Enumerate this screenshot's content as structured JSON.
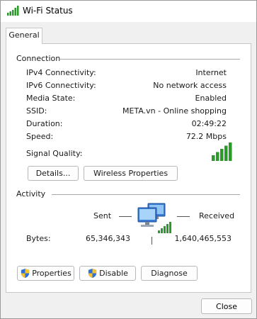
{
  "window": {
    "title": "Wi-Fi Status"
  },
  "tabs": [
    {
      "label": "General"
    }
  ],
  "connection": {
    "heading": "Connection",
    "rows": [
      {
        "label": "IPv4 Connectivity:",
        "value": "Internet"
      },
      {
        "label": "IPv6 Connectivity:",
        "value": "No network access"
      },
      {
        "label": "Media State:",
        "value": "Enabled"
      },
      {
        "label": "SSID:",
        "value": "META.vn - Online shopping"
      },
      {
        "label": "Duration:",
        "value": "02:49:22"
      },
      {
        "label": "Speed:",
        "value": "72.2 Mbps"
      }
    ],
    "signal_label": "Signal Quality:",
    "signal_bars": 5,
    "details_button": "Details...",
    "wireless_button": "Wireless Properties"
  },
  "activity": {
    "heading": "Activity",
    "sent_label": "Sent",
    "received_label": "Received",
    "bytes_label": "Bytes:",
    "bytes_sent": "65,346,343",
    "bytes_received": "1,640,465,553",
    "properties_button": "Properties",
    "disable_button": "Disable",
    "diagnose_button": "Diagnose"
  },
  "footer": {
    "close_button": "Close"
  },
  "colors": {
    "signal": "#2a9a2a",
    "shield_blue": "#2f6fd6",
    "shield_yellow": "#f2c230"
  },
  "icons": {
    "title": "wifi-signal-icon",
    "activity": "network-computers-icon",
    "button_shield": "uac-shield-icon"
  }
}
